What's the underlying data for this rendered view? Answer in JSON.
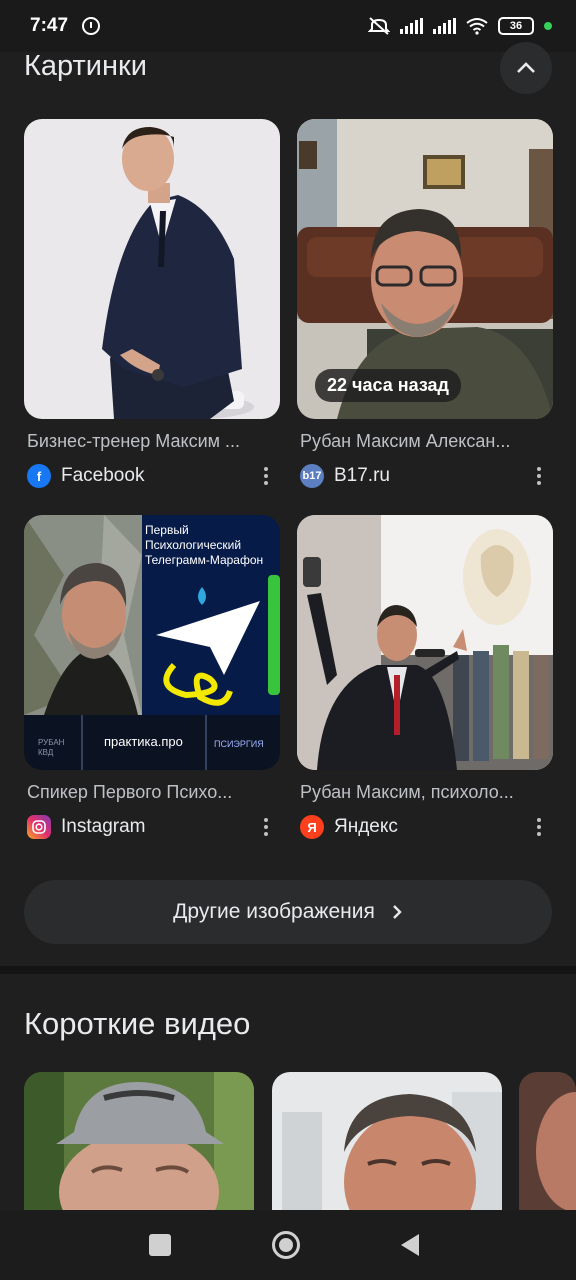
{
  "status": {
    "time": "7:47",
    "battery": "36"
  },
  "images_section": {
    "title": "Картинки",
    "cards": [
      {
        "title": "Бизнес-тренер Максим ...",
        "source": "Facebook",
        "source_icon": "facebook-icon",
        "color": "#1877f2"
      },
      {
        "title": "Рубан Максим Алексан...",
        "source": "B17.ru",
        "source_icon": "b17-icon",
        "color": "#4a6fb0",
        "badge": "22 часа назад"
      },
      {
        "title": "Спикер Первого Психо...",
        "source": "Instagram",
        "source_icon": "instagram-icon",
        "color": "#e1306c"
      },
      {
        "title": "Рубан Максим, психоло...",
        "source": "Яндекс",
        "source_icon": "yandex-icon",
        "color": "#fc3f1d"
      }
    ],
    "marathon_text": "Первый Психологический Телеграмм-Марафон",
    "practica_text": "практика.про",
    "more_button": "Другие изображения"
  },
  "videos_section": {
    "title": "Короткие видео"
  }
}
